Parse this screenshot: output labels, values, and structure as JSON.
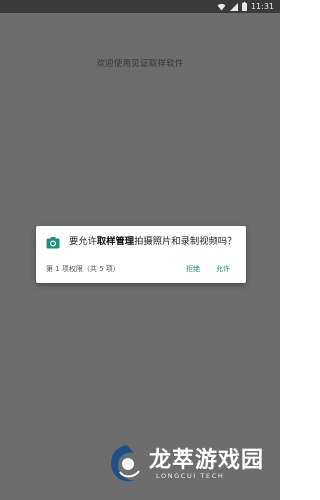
{
  "status_bar": {
    "time": "11:31",
    "icons": [
      "wifi-icon",
      "signal-icon",
      "battery-icon"
    ]
  },
  "app": {
    "welcome_text": "欢迎使用见证取样软件"
  },
  "permission_dialog": {
    "icon": "camera-icon",
    "message_prefix": "要允许",
    "app_name": "取样管理",
    "message_suffix": "拍摄照片和录制视频吗？",
    "page_indicator": "第 1 项权限（共 5 项）",
    "deny_label": "拒绝",
    "allow_label": "允许",
    "accent_color": "#1a8f84"
  },
  "watermark": {
    "title": "龙萃游戏园",
    "subtitle": "LONGCUI TECH"
  }
}
